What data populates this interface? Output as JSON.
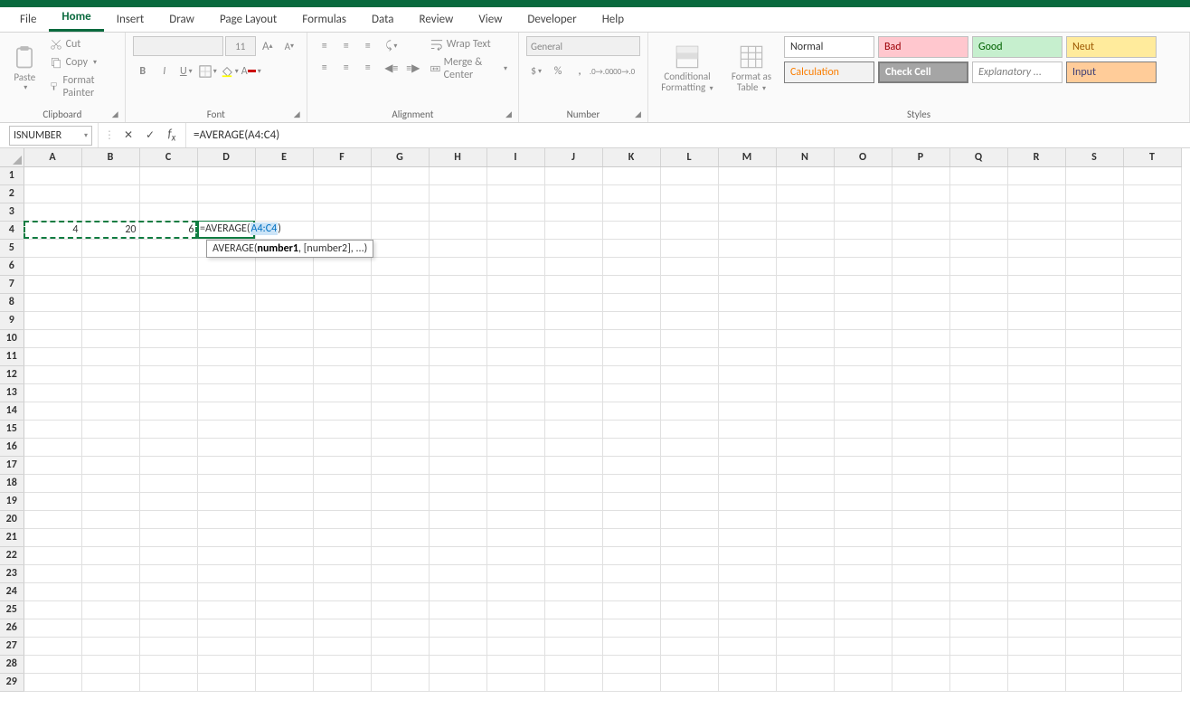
{
  "tabs": [
    "File",
    "Home",
    "Insert",
    "Draw",
    "Page Layout",
    "Formulas",
    "Data",
    "Review",
    "View",
    "Developer",
    "Help"
  ],
  "active_tab": "Home",
  "clipboard": {
    "paste": "Paste",
    "cut": "Cut",
    "copy": "Copy",
    "format_painter": "Format Painter",
    "label": "Clipboard"
  },
  "font": {
    "label": "Font",
    "size": "11"
  },
  "alignment": {
    "label": "Alignment",
    "wrap": "Wrap Text",
    "merge": "Merge & Center"
  },
  "number": {
    "label": "Number",
    "format": "General"
  },
  "styles": {
    "label": "Styles",
    "cond_fmt": "Conditional Formatting",
    "fmt_table": "Format as Table",
    "cells": [
      "Normal",
      "Bad",
      "Good",
      "Neut",
      "Calculation",
      "Check Cell",
      "Explanatory ...",
      "Input"
    ]
  },
  "namebox": "ISNUMBER",
  "formula": "=AVERAGE(A4:C4)",
  "columns": [
    "A",
    "B",
    "C",
    "D",
    "E",
    "F",
    "G",
    "H",
    "I",
    "J",
    "K",
    "L",
    "M",
    "N",
    "O",
    "P",
    "Q",
    "R",
    "S",
    "T"
  ],
  "row_count": 29,
  "cells": {
    "A4": "4",
    "B4": "20",
    "C4": "6"
  },
  "inline_edit": {
    "prefix": "=AVERAGE(",
    "range": "A4:C4",
    "suffix": ")"
  },
  "tooltip": {
    "fn": "AVERAGE(",
    "arg1": "number1",
    "rest": ", [number2], ...)"
  },
  "chart_data": null
}
